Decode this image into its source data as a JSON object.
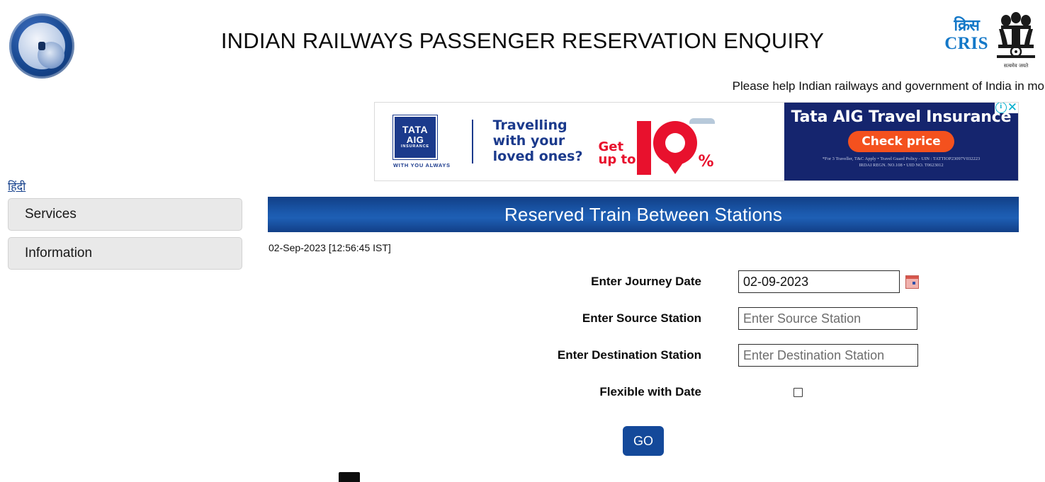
{
  "header": {
    "title": "INDIAN RAILWAYS PASSENGER RESERVATION ENQUIRY",
    "railways_logo_name": "indian-railways-emblem",
    "cris_hindi": "क्रिस",
    "cris_text": "CRIS",
    "emblem_caption": "सत्यमेव जयते",
    "marquee": "Please help Indian railways and government of India in mo"
  },
  "ad": {
    "tata_line1": "TATA",
    "tata_line2": "AIG",
    "tata_line3": "INSURANCE",
    "tata_tagline": "WITH YOU ALWAYS",
    "headline_line1": "Travelling",
    "headline_line2": "with your",
    "headline_line3": "loved ones?",
    "offer_get": "Get",
    "offer_upto": "up to",
    "offer_number": "10",
    "offer_percent": "%",
    "right_title": "Tata AIG Travel Insurance",
    "cta_label": "Check price",
    "fine_print_line1": "*For 3 Traveller, T&C Apply  •  Travel Guard Policy - UIN : TATTIOP23097V032223",
    "fine_print_line2": "IRDAI REGN. NO.108  •  UID NO. T0623012",
    "info_icon": "ⓘ",
    "close_icon": "✕"
  },
  "sidebar": {
    "hindi_link": "हिंदी",
    "items": [
      {
        "label": "Services"
      },
      {
        "label": "Information"
      }
    ]
  },
  "main": {
    "panel_title": "Reserved Train Between Stations",
    "timestamp": "02-Sep-2023 [12:56:45 IST]",
    "fields": {
      "journey_date": {
        "label": "Enter Journey Date",
        "value": "02-09-2023",
        "calendar_icon": "calendar-icon"
      },
      "source_station": {
        "label": "Enter Source Station",
        "placeholder": "Enter Source Station",
        "value": ""
      },
      "destination_station": {
        "label": "Enter Destination Station",
        "placeholder": "Enter Destination Station",
        "value": ""
      },
      "flexible_with_date": {
        "label": "Flexible with Date",
        "checked": false
      }
    },
    "submit_label": "GO"
  },
  "colors": {
    "panel_blue": "#1b59ad",
    "go_button": "#14499a",
    "cris_blue": "#1478c8",
    "ad_navy": "#15256e",
    "ad_orange": "#f4511e",
    "ad_red": "#e8112d",
    "hindi_link": "#16418c"
  }
}
